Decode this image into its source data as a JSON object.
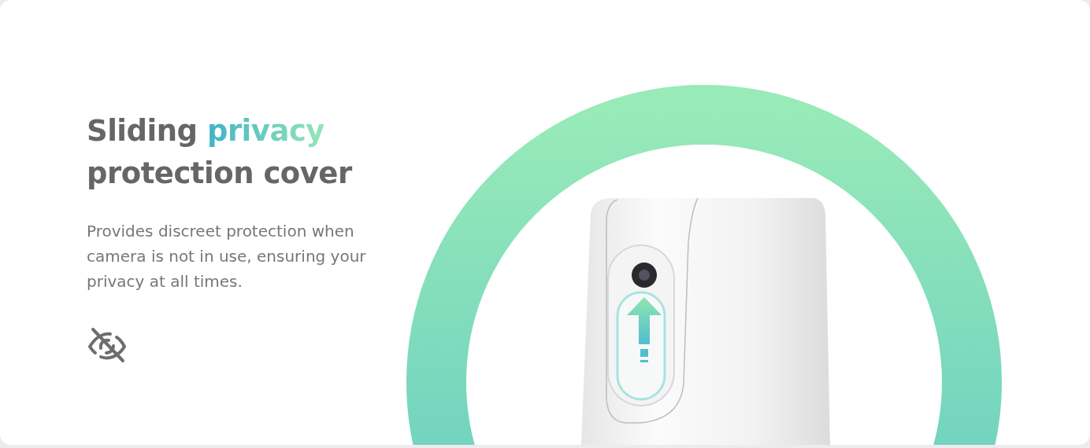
{
  "heading": {
    "before": "Sliding ",
    "highlight": "privacy",
    "after": "protection cover"
  },
  "description": "Provides discreet protection when camera is not in use, ensuring your privacy at all times.",
  "feature_icon": {
    "kind": "eye-off"
  }
}
